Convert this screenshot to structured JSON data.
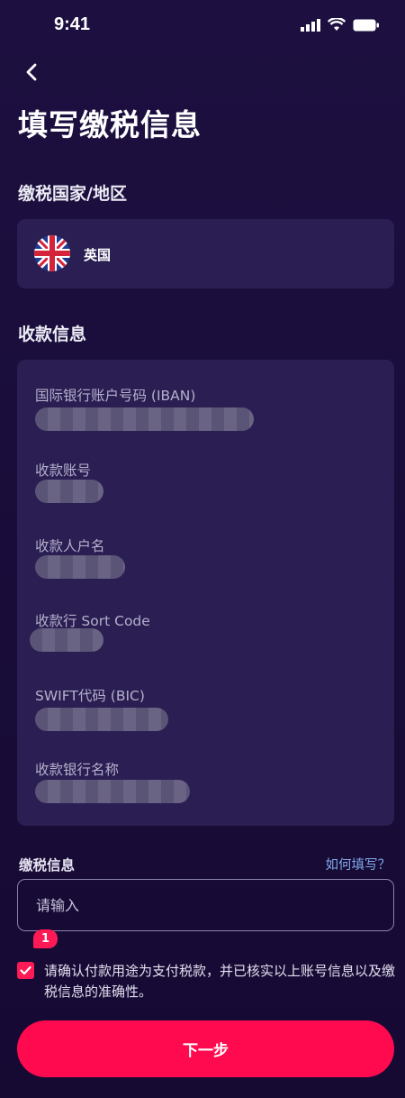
{
  "status_bar": {
    "time": "9:41"
  },
  "header": {
    "title": "填写缴税信息"
  },
  "country_section": {
    "label": "缴税国家/地区",
    "country": "英国"
  },
  "payee_section": {
    "label": "收款信息",
    "fields": [
      {
        "label": "国际银行账户号码 (IBAN)"
      },
      {
        "label": "收款账号"
      },
      {
        "label": "收款人户名"
      },
      {
        "label": "收款行 Sort Code"
      },
      {
        "label": "SWIFT代码 (BIC)"
      },
      {
        "label": "收款银行名称"
      }
    ]
  },
  "tax_info": {
    "label": "缴税信息",
    "help_link": "如何填写？",
    "placeholder": "请输入",
    "value": ""
  },
  "tip_badge": "1",
  "confirm": {
    "checked": true,
    "text": "请确认付款用途为支付税款，并已核实以上账号信息以及缴税信息的准确性。"
  },
  "next_button": {
    "label": "下一步"
  },
  "colors": {
    "accent": "#ff0a4f",
    "link": "#7fa8e8",
    "card": "#2a1e52",
    "background": "#1a0d3b"
  }
}
